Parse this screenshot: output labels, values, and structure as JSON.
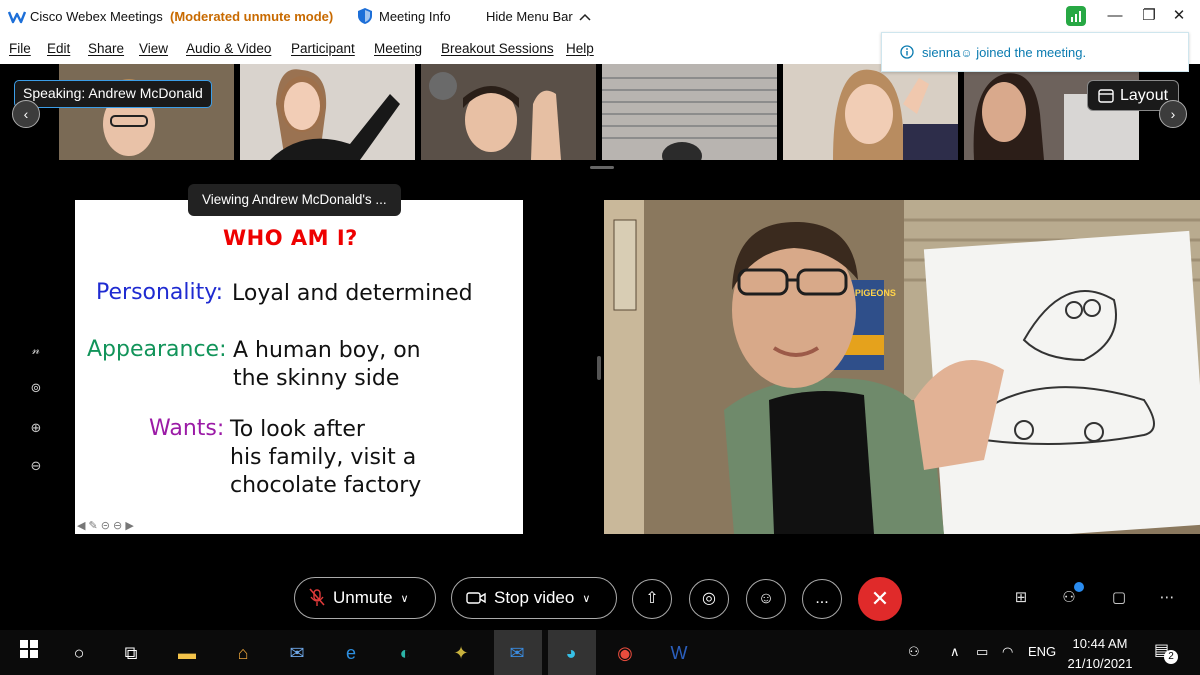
{
  "titlebar": {
    "app_title": "Cisco Webex Meetings",
    "mode": "(Moderated unmute mode)",
    "meeting_info": "Meeting Info",
    "hide_menu": "Hide Menu Bar",
    "window_controls": [
      "minimize-icon",
      "restore-icon",
      "close-icon"
    ]
  },
  "menu": [
    "File",
    "Edit",
    "Share",
    "View",
    "Audio & Video",
    "Participant",
    "Meeting",
    "Breakout Sessions",
    "Help"
  ],
  "notification": {
    "user": "sienna",
    "text": "joined the meeting."
  },
  "participants": {
    "speaking_label": "Speaking:",
    "speaking_name": "Andrew McDonald",
    "layout_label": "Layout",
    "tile_colors": [
      "#7a6a55",
      "#d9d3cd",
      "#5a5048",
      "#b8b4b0",
      "#d8cfc4",
      "#6d625c"
    ]
  },
  "share": {
    "viewing_label": "Viewing Andrew McDonald's ...",
    "slide": {
      "title": "WHO AM I?",
      "rows": [
        {
          "label": "Personality:",
          "label_color": "#1f2bd1",
          "lines": [
            "Loyal and determined"
          ]
        },
        {
          "label": "Appearance:",
          "label_color": "#12945a",
          "lines": [
            "A human boy, on",
            "the skinny side"
          ]
        },
        {
          "label": "Wants:",
          "label_color": "#9b1aa6",
          "lines": [
            "To look after",
            "his family, visit a",
            "chocolate factory"
          ]
        }
      ]
    }
  },
  "video": {
    "book_title": "REAL PIGEONS",
    "cardigan_color": "#6f8a6b",
    "shirt_color": "#111111"
  },
  "controls": {
    "unmute": "Unmute",
    "stop_video": "Stop video",
    "more": "...",
    "end_call": "✕"
  },
  "taskbar": {
    "language": "ENG",
    "time": "10:44 AM",
    "date": "21/10/2021",
    "notifications": "2"
  }
}
